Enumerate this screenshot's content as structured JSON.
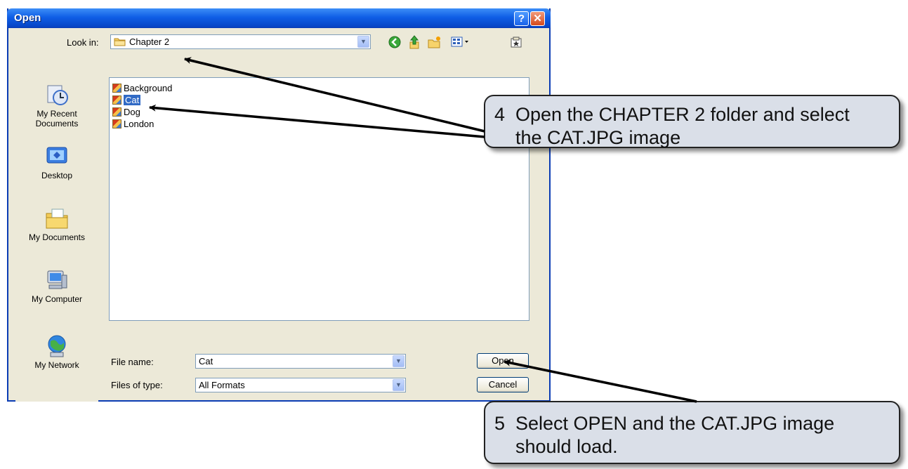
{
  "dialog": {
    "title": "Open",
    "help_label": "?",
    "close_label": "✕"
  },
  "lookin": {
    "label": "Look in:",
    "value": "Chapter 2"
  },
  "toolbar": {
    "icons": [
      "back-icon",
      "up-folder-icon",
      "new-folder-icon",
      "views-menu-icon",
      "tools-icon"
    ]
  },
  "places": [
    {
      "label": "My Recent Documents",
      "icon": "recent-documents-icon"
    },
    {
      "label": "Desktop",
      "icon": "desktop-icon"
    },
    {
      "label": "My Documents",
      "icon": "my-documents-icon"
    },
    {
      "label": "My Computer",
      "icon": "my-computer-icon"
    },
    {
      "label": "My Network",
      "icon": "my-network-icon"
    }
  ],
  "files": [
    {
      "name": "Background",
      "selected": false
    },
    {
      "name": "Cat",
      "selected": true
    },
    {
      "name": "Dog",
      "selected": false
    },
    {
      "name": "London",
      "selected": false
    }
  ],
  "filename": {
    "label": "File name:",
    "value": "Cat"
  },
  "filetype": {
    "label": "Files of type:",
    "value": "All Formats"
  },
  "buttons": {
    "open": "Open",
    "cancel": "Cancel"
  },
  "callouts": {
    "step4": {
      "number": "4",
      "text": "Open the CHAPTER 2 folder and select the CAT.JPG image"
    },
    "step5": {
      "number": "5",
      "text": "Select OPEN and the CAT.JPG image should load."
    }
  },
  "colors": {
    "titlebar": "#0f5ee6",
    "dialog_bg": "#ece9d8",
    "selection": "#316ac5",
    "callout_bg": "#dadfe8"
  }
}
